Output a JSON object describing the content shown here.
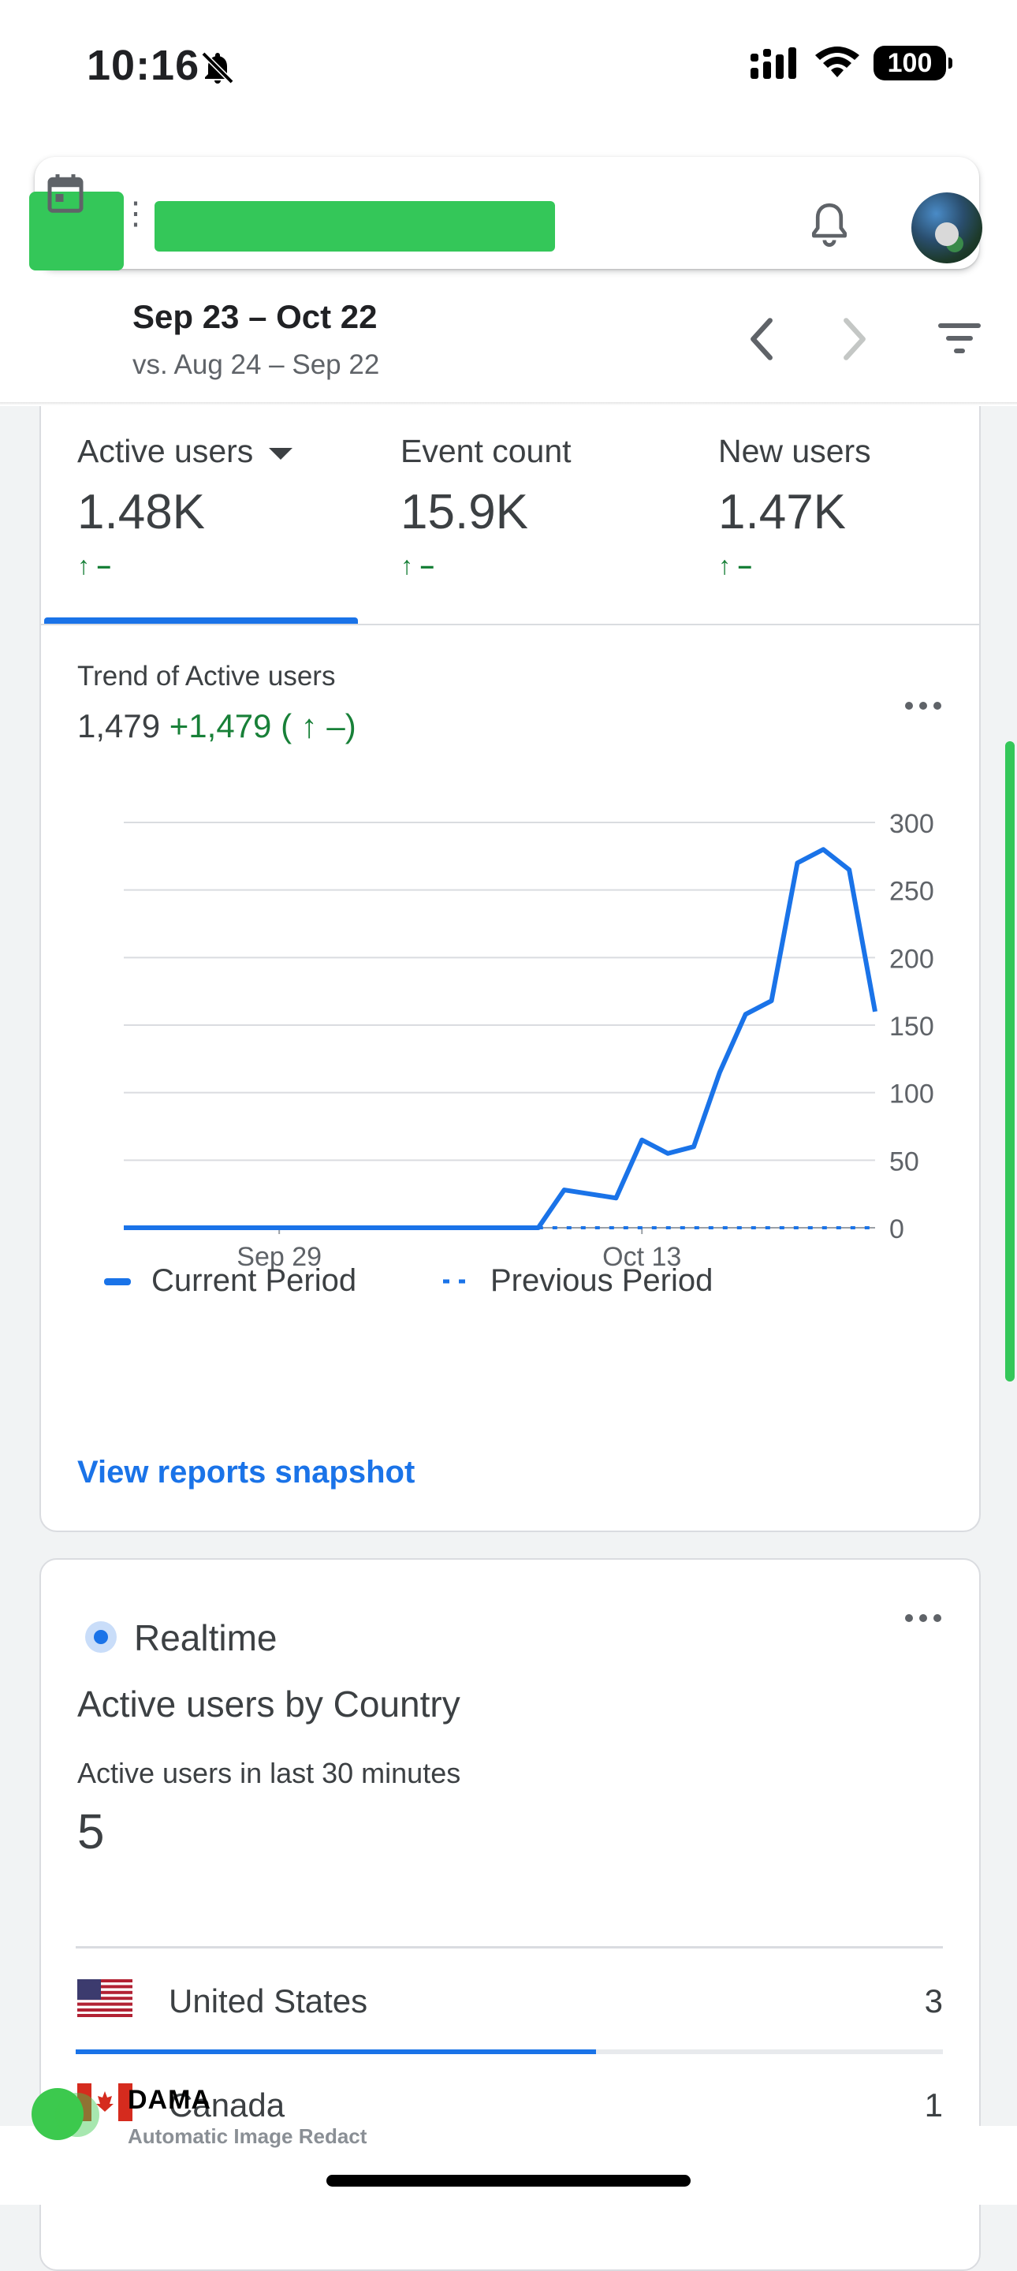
{
  "status_bar": {
    "time": "10:16",
    "battery": "100",
    "icons": [
      "bell-slash-icon",
      "signal-icon",
      "wifi-icon",
      "battery-icon"
    ]
  },
  "header": {
    "icons": [
      "menu-icon",
      "notifications-icon",
      "avatar"
    ],
    "date_range": "Sep 23 – Oct 22",
    "compare_range": "vs. Aug 24 – Sep 22"
  },
  "metrics": {
    "tabs": [
      {
        "label": "Active users",
        "value": "1.48K",
        "change": "↑ –",
        "selected": true
      },
      {
        "label": "Event count",
        "value": "15.9K",
        "change": "↑ –",
        "selected": false
      },
      {
        "label": "New users",
        "value": "1.47K",
        "change": "↑ –",
        "selected": false
      }
    ]
  },
  "trend": {
    "title": "Trend of Active users",
    "total": "1,479",
    "delta": "+1,479 ( ↑ –)",
    "view_link": "View reports snapshot"
  },
  "chart_data": {
    "type": "line",
    "title": "Trend of Active users",
    "xlabel": "",
    "ylabel": "",
    "ylim": [
      0,
      300
    ],
    "yticks": [
      0,
      50,
      100,
      150,
      200,
      250,
      300
    ],
    "y_axis_position": "right",
    "grid": true,
    "legend_placement": "bottom",
    "x": [
      "Sep 23",
      "Sep 24",
      "Sep 25",
      "Sep 26",
      "Sep 27",
      "Sep 28",
      "Sep 29",
      "Sep 30",
      "Oct 1",
      "Oct 2",
      "Oct 3",
      "Oct 4",
      "Oct 5",
      "Oct 6",
      "Oct 7",
      "Oct 8",
      "Oct 9",
      "Oct 10",
      "Oct 11",
      "Oct 12",
      "Oct 13",
      "Oct 14",
      "Oct 15",
      "Oct 16",
      "Oct 17",
      "Oct 18",
      "Oct 19",
      "Oct 20",
      "Oct 21",
      "Oct 22"
    ],
    "xtick_labels": [
      "Sep 29",
      "Oct 13"
    ],
    "series": [
      {
        "name": "Current Period",
        "style": "solid",
        "color": "#1a73e8",
        "values": [
          0,
          0,
          0,
          0,
          0,
          0,
          0,
          0,
          0,
          0,
          0,
          0,
          0,
          0,
          0,
          0,
          0,
          28,
          25,
          22,
          65,
          55,
          60,
          115,
          158,
          168,
          270,
          280,
          265,
          160
        ]
      },
      {
        "name": "Previous Period",
        "style": "dashed",
        "color": "#1a73e8",
        "values": [
          null,
          null,
          null,
          null,
          null,
          null,
          null,
          null,
          null,
          null,
          null,
          null,
          null,
          null,
          null,
          null,
          0,
          0,
          0,
          0,
          0,
          0,
          0,
          0,
          0,
          0,
          0,
          0,
          0,
          0
        ]
      }
    ]
  },
  "realtime": {
    "label": "Realtime",
    "heading": "Active users by Country",
    "sublabel": "Active users in last 30 minutes",
    "value": "5",
    "countries": [
      {
        "name": "United States",
        "count": "3",
        "share": 0.6
      },
      {
        "name": "Canada",
        "count": "1",
        "share": 0.2
      }
    ]
  },
  "watermark": {
    "brand": "DAMA",
    "subtitle": "Automatic Image Redact"
  }
}
